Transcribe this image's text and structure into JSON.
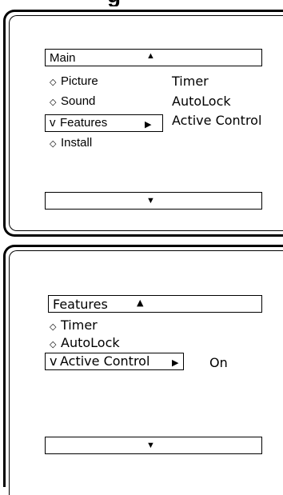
{
  "header_fragment": "g",
  "screen1": {
    "header_box": {
      "label": "Main",
      "scroll_up_icon": "up-triangle"
    },
    "menu": [
      {
        "bullet": "◇",
        "label": "Picture"
      },
      {
        "bullet": "◇",
        "label": "Sound"
      },
      {
        "bullet": "v",
        "label": "Features",
        "selected": true,
        "arrow": "▶"
      },
      {
        "bullet": "◇",
        "label": "Install"
      }
    ],
    "submenu": [
      "Timer",
      "AutoLock",
      "Active Control"
    ],
    "footer_box": {
      "scroll_down_icon": "down-triangle"
    }
  },
  "screen2": {
    "header_box": {
      "label": "Features",
      "scroll_up_icon": "up-triangle"
    },
    "menu": [
      {
        "bullet": "◇",
        "label": "Timer"
      },
      {
        "bullet": "◇",
        "label": "AutoLock"
      },
      {
        "bullet": "v",
        "label": "Active Control",
        "selected": true,
        "arrow": "▶"
      }
    ],
    "value": "On",
    "footer_box": {
      "scroll_down_icon": "down-triangle"
    }
  },
  "glyphs": {
    "up": "▲",
    "down": "▼"
  }
}
